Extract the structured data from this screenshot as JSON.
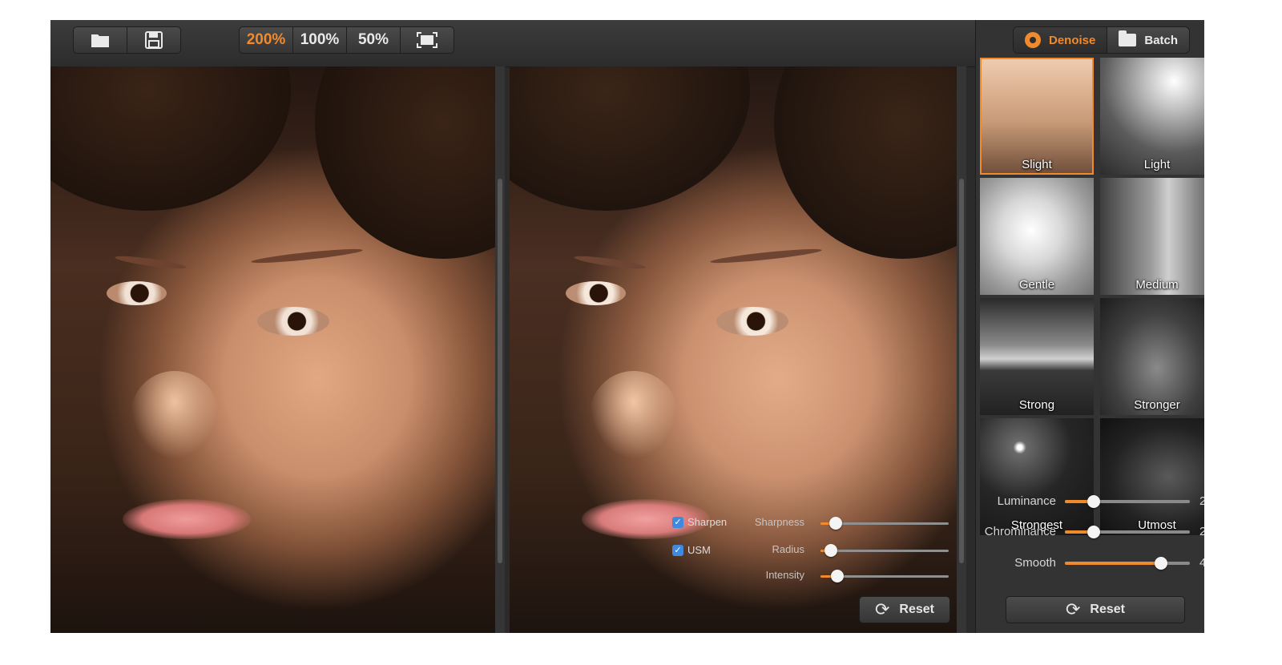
{
  "toolbar": {
    "file_buttons": [
      {
        "icon": "folder-open-icon"
      },
      {
        "icon": "save-disk-icon"
      }
    ],
    "zoom_buttons": [
      {
        "label": "200%",
        "active": true
      },
      {
        "label": "100%",
        "active": false
      },
      {
        "label": "50%",
        "active": false
      },
      {
        "icon": "fit-to-screen-icon"
      }
    ]
  },
  "side": {
    "modes": [
      {
        "label": "Denoise",
        "icon": "gear-icon",
        "active": true
      },
      {
        "label": "Batch",
        "icon": "folder-icon",
        "active": false
      }
    ],
    "presets": [
      {
        "label": "Slight",
        "selected": true
      },
      {
        "label": "Light",
        "selected": false
      },
      {
        "label": "Gentle",
        "selected": false
      },
      {
        "label": "Medium",
        "selected": false
      },
      {
        "label": "Strong",
        "selected": false
      },
      {
        "label": "Stronger",
        "selected": false
      },
      {
        "label": "Strongest",
        "selected": false
      },
      {
        "label": "Utmost",
        "selected": false
      }
    ],
    "sliders": [
      {
        "label": "Luminance",
        "value": "2",
        "fraction": 0.23
      },
      {
        "label": "Chrominance",
        "value": "2",
        "fraction": 0.23
      },
      {
        "label": "Smooth",
        "value": "4",
        "fraction": 0.77
      }
    ],
    "reset_label": "Reset"
  },
  "sharpen": {
    "checkboxes": [
      {
        "label": "Sharpen",
        "checked": true
      },
      {
        "label": "USM",
        "checked": true
      }
    ],
    "sliders": [
      {
        "label": "Sharpness",
        "fraction": 0.12
      },
      {
        "label": "Radius",
        "fraction": 0.08
      },
      {
        "label": "Intensity",
        "fraction": 0.13
      }
    ],
    "reset_label": "Reset"
  },
  "colors": {
    "accent": "#f08a2c",
    "toolbar_bg": "#333333",
    "panel_bg": "#2b2b2b"
  }
}
